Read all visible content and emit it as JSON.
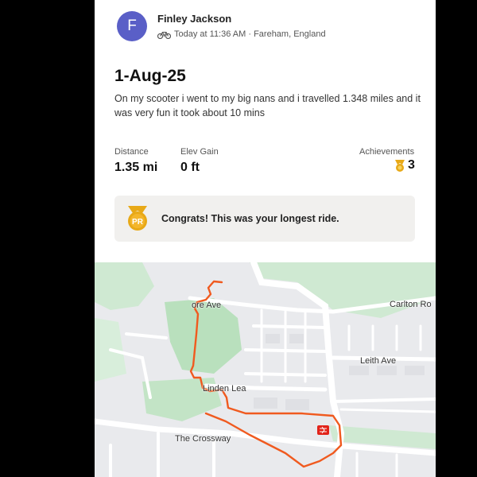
{
  "activity": {
    "athlete_name": "Finley Jackson",
    "avatar_initial": "F",
    "meta_text": "Today at 11:36 AM · Fareham, England",
    "activity_icon": "bike-icon",
    "title": "1-Aug-25",
    "description": "On my scooter i went to my big nans and i travelled 1.348 miles and it was very fun it took about 10 mins"
  },
  "stats": {
    "distance_label": "Distance",
    "distance_value": "1.35 mi",
    "elev_label": "Elev Gain",
    "elev_value": "0 ft",
    "achievements_label": "Achievements",
    "achievements_value": "3",
    "achievement_icon": "medal-icon"
  },
  "banner": {
    "icon": "pr-medal-icon",
    "icon_text": "PR",
    "text": "Congrats! This was your longest ride."
  },
  "map": {
    "route_color": "#f05a1f",
    "station_icon": "rail-station-icon",
    "road_labels": {
      "more_ave": "ore Ave",
      "carlton": "Carlton Ro",
      "leith": "Leith Ave",
      "linden": "Linden Lea",
      "crossway": "The Crossway"
    }
  },
  "colors": {
    "avatar": "#5a5fc7",
    "banner_bg": "#f1f0ee",
    "medal": "#e8a917"
  }
}
